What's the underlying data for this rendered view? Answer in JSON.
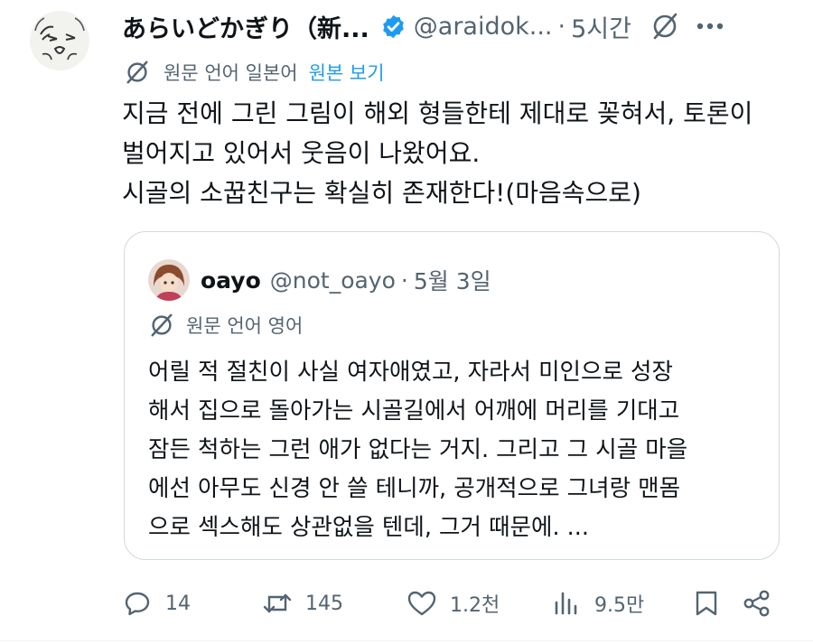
{
  "tweet": {
    "display_name": "あらいどかぎり（新...",
    "handle": "@araidok...",
    "time": "5시간",
    "translation_label": "원문 언어 일본어",
    "show_original": "원본 보기",
    "lines": [
      "지금 전에 그린 그림이 해외 형들한테 제대로 꽂혀서, 토론이",
      "벌어지고 있어서 웃음이 나왔어요.",
      "시골의 소꿉친구는 확실히 존재한다!(마음속으로)"
    ]
  },
  "quote": {
    "name": "oayo",
    "handle": "@not_oayo",
    "date": "5월 3일",
    "translation_label": "원문 언어 영어",
    "lines": [
      "어릴 적 절친이 사실 여자애였고, 자라서 미인으로 성장",
      "해서 집으로 돌아가는 시골길에서 어깨에 머리를 기대고",
      "잠든 척하는 그런 애가 없다는 거지. 그리고 그 시골 마을",
      "에선 아무도 신경 안 쓸 테니까, 공개적으로 그녀랑 맨몸",
      "으로 섹스해도 상관없을 텐데, 그거 때문에. ..."
    ]
  },
  "actions": {
    "replies": "14",
    "reposts": "145",
    "likes": "1.2천",
    "views": "9.5만"
  },
  "colors": {
    "text": "#0f1419",
    "secondary": "#536471",
    "accent": "#1d9bf0",
    "border": "#cfd9de"
  },
  "icons": [
    "verified-icon",
    "translate-icon",
    "more-icon",
    "reply-icon",
    "repost-icon",
    "like-icon",
    "views-icon",
    "bookmark-icon",
    "share-icon"
  ]
}
